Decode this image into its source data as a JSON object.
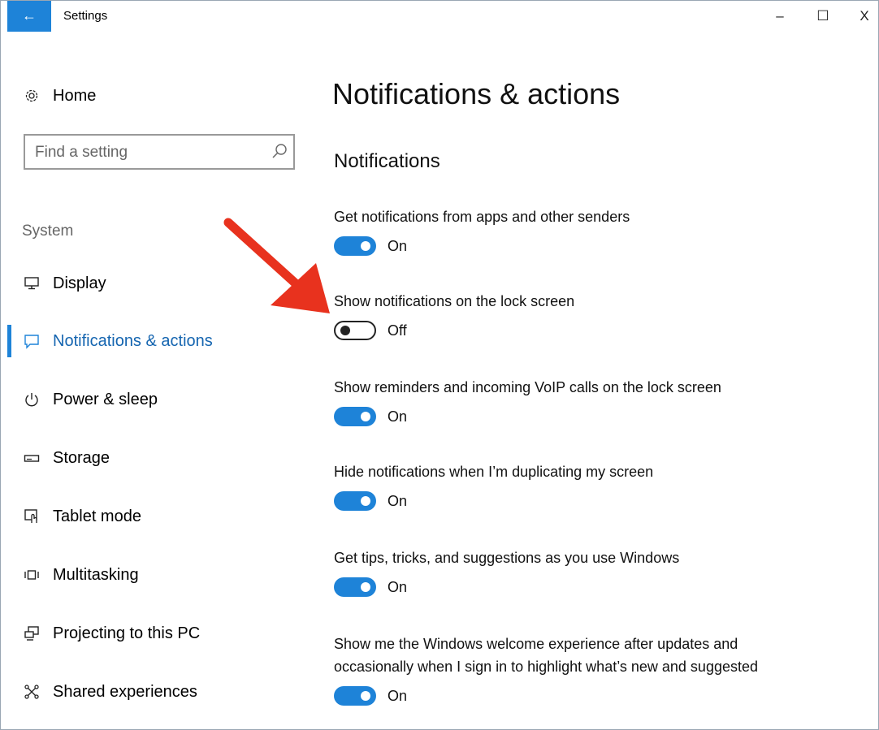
{
  "window": {
    "title": "Settings",
    "back_label": "←",
    "minimize_label": "–",
    "maximize_label": "☐",
    "close_label": "X"
  },
  "sidebar": {
    "home_label": "Home",
    "search_placeholder": "Find a setting",
    "group_label": "System",
    "items": [
      {
        "label": "Display",
        "icon": "monitor-icon",
        "active": false
      },
      {
        "label": "Notifications & actions",
        "icon": "message-icon",
        "active": true
      },
      {
        "label": "Power & sleep",
        "icon": "power-icon",
        "active": false
      },
      {
        "label": "Storage",
        "icon": "storage-icon",
        "active": false
      },
      {
        "label": "Tablet mode",
        "icon": "tablet-icon",
        "active": false
      },
      {
        "label": "Multitasking",
        "icon": "multitasking-icon",
        "active": false
      },
      {
        "label": "Projecting to this PC",
        "icon": "projector-icon",
        "active": false
      },
      {
        "label": "Shared experiences",
        "icon": "share-icon",
        "active": false
      }
    ]
  },
  "main": {
    "title": "Notifications & actions",
    "section": "Notifications",
    "settings": [
      {
        "desc": "Get notifications from apps and other senders",
        "state": "On"
      },
      {
        "desc": "Show notifications on the lock screen",
        "state": "Off"
      },
      {
        "desc": "Show reminders and incoming VoIP calls on the lock screen",
        "state": "On"
      },
      {
        "desc": "Hide notifications when I’m duplicating my screen",
        "state": "On"
      },
      {
        "desc": "Get tips, tricks, and suggestions as you use Windows",
        "state": "On"
      },
      {
        "desc": "Show me the Windows welcome experience after updates and occasionally when I sign in to highlight what’s new and suggested",
        "state": "On"
      }
    ]
  },
  "colors": {
    "accent": "#1e83d8",
    "annotation_arrow": "#e8321e"
  }
}
